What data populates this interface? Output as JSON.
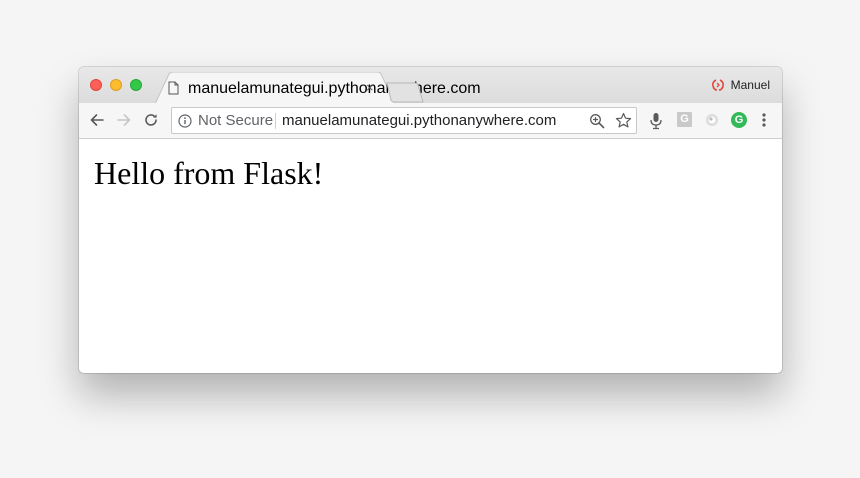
{
  "tab": {
    "title": "manuelamunategui.pythonanywhere.com",
    "close": "×"
  },
  "profile": {
    "name": "Manuel"
  },
  "address_bar": {
    "security_label": "Not Secure",
    "url": "manuelamunategui.pythonanywhere.com"
  },
  "page": {
    "heading": "Hello from Flask!"
  },
  "extensions": {
    "g_gray_label": "G",
    "g_green_label": "G"
  },
  "colors": {
    "close_light": "#fc5f57",
    "minimize_light": "#fdbc2e",
    "zoom_light": "#33c748",
    "extension_green": "#34b95a",
    "profile_icon": "#e0493a"
  }
}
